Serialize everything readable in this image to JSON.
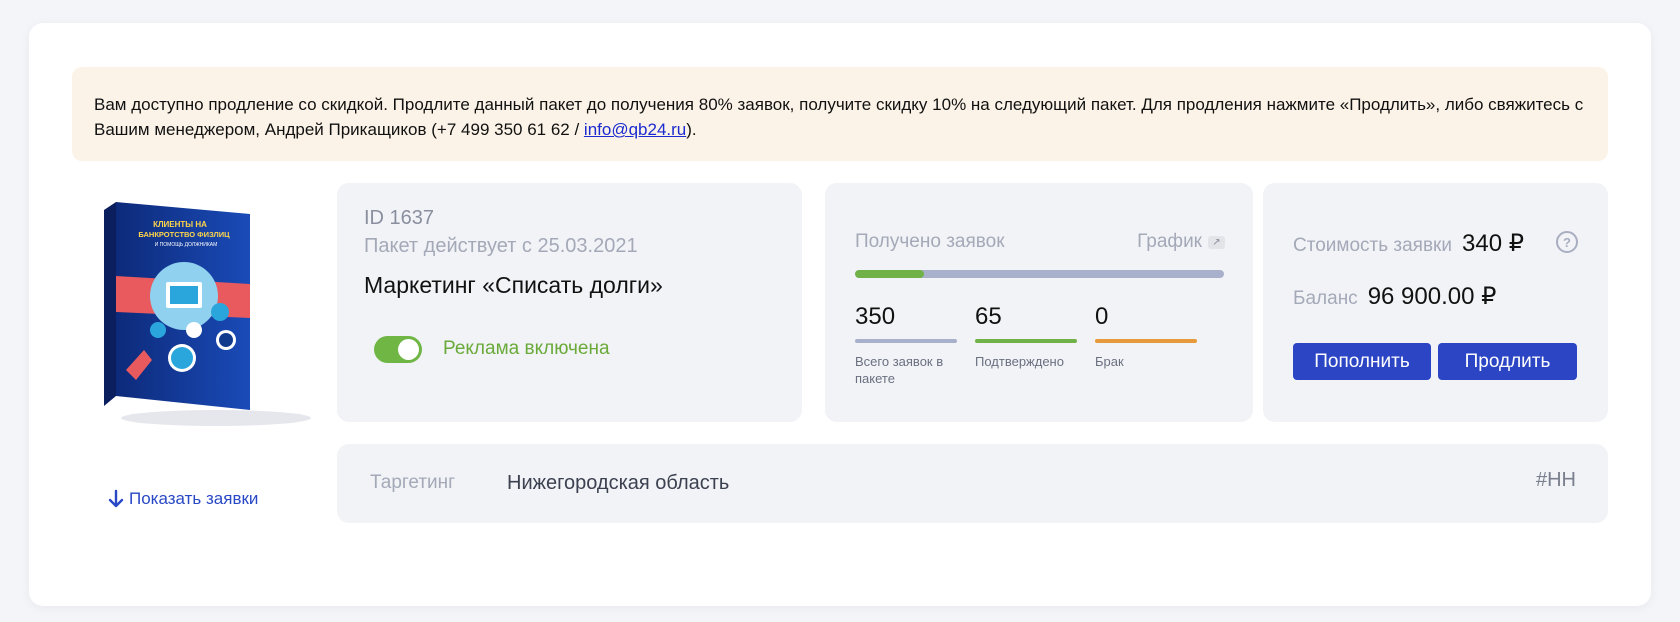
{
  "notice": {
    "text_before": "Вам доступно продление со скидкой. Продлите данный пакет до получения 80% заявок, получите скидку 10% на следующий пакет. Для продления нажмите «Продлить», либо свяжитесь с Вашим менеджером, Андрей Прикащиков (+7 499 350 61 62 / ",
    "email": "info@qb24.ru",
    "text_after": ")."
  },
  "product": {
    "box_title_line1": "КЛИЕНТЫ НА",
    "box_title_line2": "БАНКРОТСТВО ФИЗЛИЦ",
    "box_subtitle": "И ПОМОЩЬ ДОЛЖНИКАМ",
    "show_leads": "Показать заявки"
  },
  "info": {
    "id": "ID 1637",
    "since": "Пакет действует с 25.03.2021",
    "title": "Маркетинг «Списать долги»",
    "toggle_on": true,
    "toggle_label": "Реклама включена"
  },
  "leads": {
    "title": "Получено заявок",
    "graph_link": "График",
    "progress_fraction": 0.186,
    "stats": [
      {
        "value": "350",
        "caption": "Всего заявок в пакете",
        "color": "#a9b0cc"
      },
      {
        "value": "65",
        "caption": "Подтверждено",
        "color": "#71b248"
      },
      {
        "value": "0",
        "caption": "Брак",
        "color": "#e79a3c"
      }
    ]
  },
  "cost": {
    "price_label": "Стоимость заявки",
    "price_value": "340 ₽",
    "help_icon": "?",
    "balance_label": "Баланс",
    "balance_value": "96 900.00 ₽",
    "topup_button": "Пополнить",
    "extend_button": "Продлить"
  },
  "targeting": {
    "label": "Таргетинг",
    "value": "Нижегородская область",
    "tag": "#НН"
  },
  "colors": {
    "accent": "#2b45c4",
    "green": "#71b248",
    "notice_bg": "#fbf3e7"
  }
}
